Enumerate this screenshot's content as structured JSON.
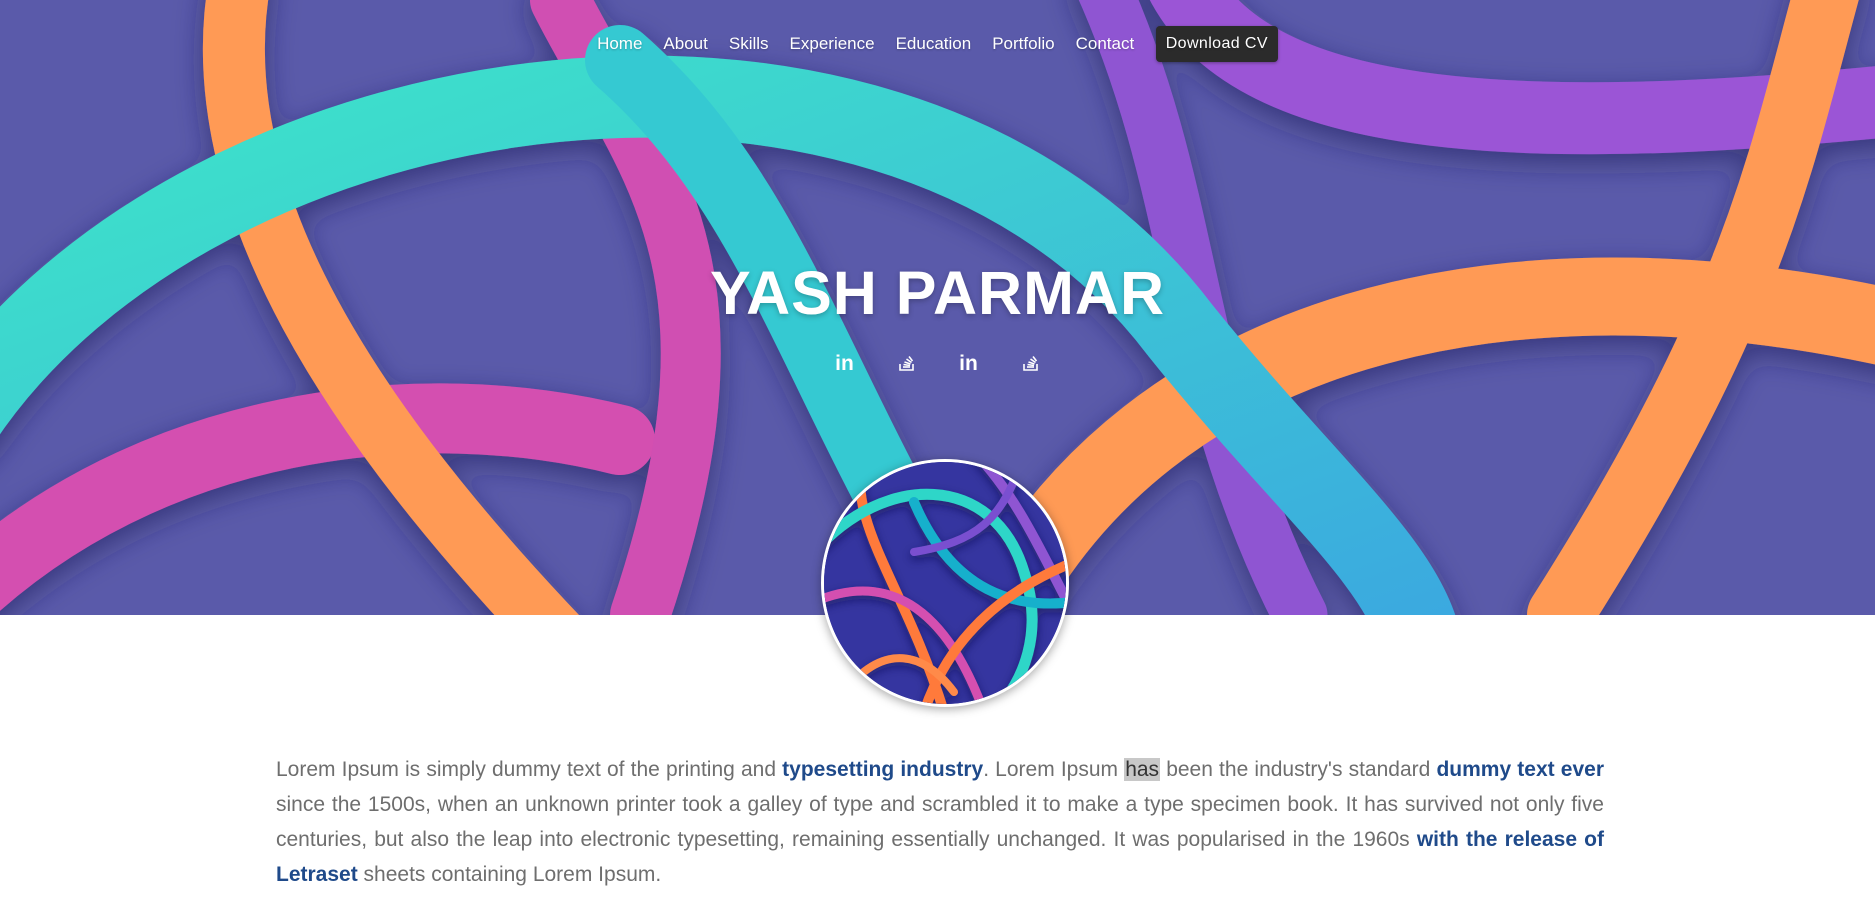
{
  "nav": {
    "items": [
      "Home",
      "About",
      "Skills",
      "Experience",
      "Education",
      "Portfolio",
      "Contact"
    ],
    "cv_label": "Download CV"
  },
  "hero": {
    "name": "YASH PARMAR",
    "social": [
      {
        "icon": "linkedin-icon",
        "glyph": "in"
      },
      {
        "icon": "stackoverflow-icon",
        "glyph": ""
      },
      {
        "icon": "linkedin-icon",
        "glyph": "in"
      },
      {
        "icon": "stackoverflow-icon",
        "glyph": ""
      }
    ]
  },
  "about": {
    "t1": "Lorem Ipsum is simply dummy text of the printing and ",
    "b1": "typesetting industry",
    "t2": ". Lorem Ipsum ",
    "hl": "has",
    "t3": " been the industry's standard ",
    "b2": "dummy text ever",
    "t4": " since the 1500s, when an unknown printer took a galley of type and scrambled it to make a type specimen book. It has survived not only five centuries, but also the leap into electronic typesetting, remaining essentially unchanged. It was popularised in the 1960s ",
    "b3": "with the release of Letraset",
    "t5": " sheets containing Lorem Ipsum."
  },
  "colors": {
    "background": "#5a5aaa",
    "teal": "#3ed8c9",
    "orange": "#ff9a55",
    "purple": "#9b55d6",
    "pink": "#d44fb0",
    "accent_text": "#1f4a8a",
    "cv_button": "#2b2b2b"
  }
}
